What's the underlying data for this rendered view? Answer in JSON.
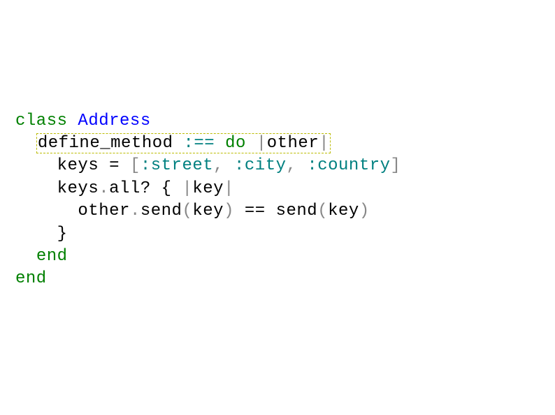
{
  "code": {
    "line1": {
      "class_kw": "class",
      "class_name": "Address"
    },
    "line2": {
      "define_method": "define_method",
      "eq_sym": ":==",
      "do_kw": "do",
      "pipe1": "|",
      "other": "other",
      "pipe2": "|"
    },
    "line3": {
      "keys": "keys",
      "equals": " = ",
      "lbracket": "[",
      "street": ":street",
      "comma1": ", ",
      "city": ":city",
      "comma2": ", ",
      "country": ":country",
      "rbracket": "]"
    },
    "line4": {
      "keys": "keys",
      "dot": ".",
      "all": "all?",
      "brace_open": " { ",
      "pipe1": "|",
      "key": "key",
      "pipe2": "|"
    },
    "line5": {
      "other": "other",
      "dot": ".",
      "send1": "send",
      "lparen1": "(",
      "key1": "key",
      "rparen1": ")",
      "eq": " == ",
      "send2": "send",
      "lparen2": "(",
      "key2": "key",
      "rparen2": ")"
    },
    "line6": {
      "brace_close": "}"
    },
    "line7": {
      "end": "end"
    },
    "line8": {
      "end": "end"
    }
  }
}
